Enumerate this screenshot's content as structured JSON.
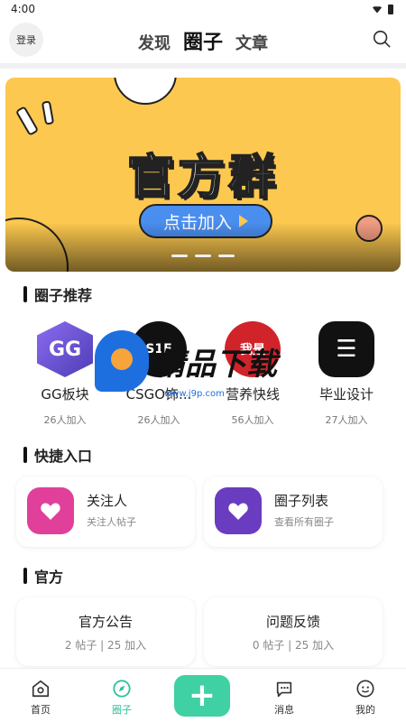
{
  "status_bar": {
    "time": "4:00"
  },
  "header": {
    "login_label": "登录",
    "tabs": [
      {
        "label": "发现"
      },
      {
        "label": "圈子"
      },
      {
        "label": "文章"
      }
    ],
    "active_tab": "圈子"
  },
  "banner": {
    "title": "官方群",
    "cta_label": "点击加入",
    "accent_color": "#fdc84f",
    "cta_color": "#4a8ef0"
  },
  "sections": {
    "recommended_title": "圈子推荐",
    "shortcuts_title": "快捷入口",
    "official_title": "官方"
  },
  "recommended": [
    {
      "icon_text": "GG",
      "name": "GG板块",
      "count": "26人加入"
    },
    {
      "icon_text": "S1F",
      "name": "CSGO饰...",
      "count": "26人加入"
    },
    {
      "icon_text": "我是",
      "name": "营养快线",
      "count": "56人加入"
    },
    {
      "icon_text": "☰",
      "name": "毕业设计",
      "count": "27人加入"
    }
  ],
  "shortcuts": [
    {
      "title": "关注人",
      "subtitle": "关注人帖子",
      "icon": "heart-icon",
      "color": "#e0409a"
    },
    {
      "title": "圈子列表",
      "subtitle": "查看所有圈子",
      "icon": "heart-icon",
      "color": "#6a3cc0"
    }
  ],
  "official": [
    {
      "title": "官方公告",
      "stats": "2 帖子 | 25 加入"
    },
    {
      "title": "问题反馈",
      "stats": "0 帖子 | 25 加入"
    }
  ],
  "watermark": {
    "text": "精品下载",
    "url": "www.j9p.com"
  },
  "bottom_nav": [
    {
      "label": "首页",
      "icon": "home-icon"
    },
    {
      "label": "圈子",
      "icon": "compass-icon"
    },
    {
      "label": "",
      "icon": "plus-icon"
    },
    {
      "label": "消息",
      "icon": "message-icon"
    },
    {
      "label": "我的",
      "icon": "profile-icon"
    }
  ],
  "nav_active_color": "#2cc39a"
}
